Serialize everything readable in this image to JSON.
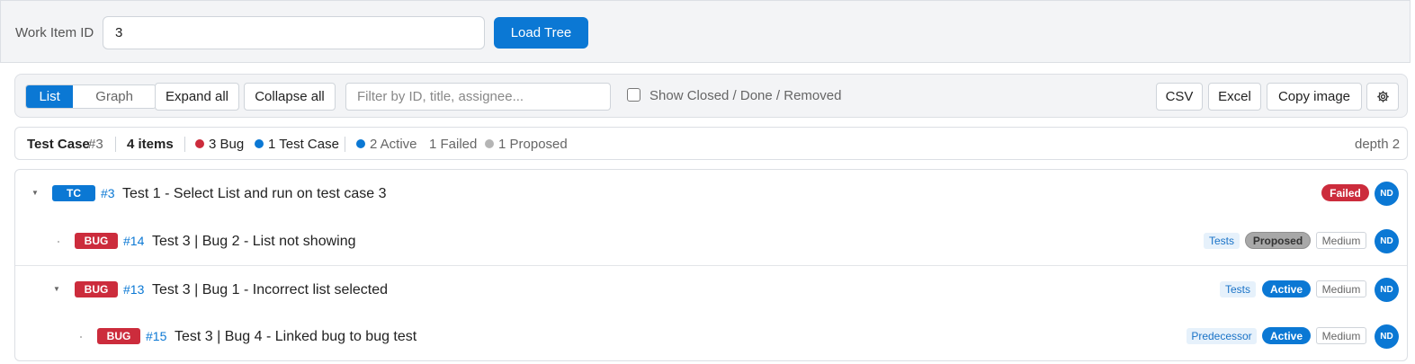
{
  "header": {
    "work_item_label": "Work Item ID",
    "work_item_value": "3",
    "load_button": "Load Tree"
  },
  "toolbar": {
    "view_list": "List",
    "view_graph": "Graph",
    "expand_all": "Expand all",
    "collapse_all": "Collapse all",
    "filter_placeholder": "Filter by ID, title, assignee...",
    "show_closed_label": "Show Closed / Done / Removed",
    "show_closed_checked": false,
    "csv": "CSV",
    "excel": "Excel",
    "copy_image": "Copy image",
    "settings_icon": "gear-icon"
  },
  "summary": {
    "root_type": "Test Case",
    "root_id": "#3",
    "item_count": "4 items",
    "bug_count": "3 Bug",
    "test_case_count": "1 Test Case",
    "active_count": "2 Active",
    "failed_count": "1 Failed",
    "proposed_count": "1 Proposed",
    "depth": "depth 2"
  },
  "colors": {
    "accent": "#0b78d4",
    "bug": "#cc2c3c",
    "proposed": "#a8a8a8"
  },
  "tree": [
    {
      "type": "TC",
      "id": "#3",
      "title": "Test 1 - Select List and run on test case 3",
      "tag": "",
      "status": "Failed",
      "priority": "",
      "assignee": "ND"
    },
    {
      "type": "BUG",
      "id": "#14",
      "title": "Test 3 | Bug 2 - List not showing",
      "tag": "Tests",
      "status": "Proposed",
      "priority": "Medium",
      "assignee": "ND"
    },
    {
      "type": "BUG",
      "id": "#13",
      "title": "Test 3 | Bug 1 - Incorrect list selected",
      "tag": "Tests",
      "status": "Active",
      "priority": "Medium",
      "assignee": "ND"
    },
    {
      "type": "BUG",
      "id": "#15",
      "title": "Test 3 | Bug 4 - Linked bug to bug test",
      "tag": "Predecessor",
      "status": "Active",
      "priority": "Medium",
      "assignee": "ND"
    }
  ]
}
